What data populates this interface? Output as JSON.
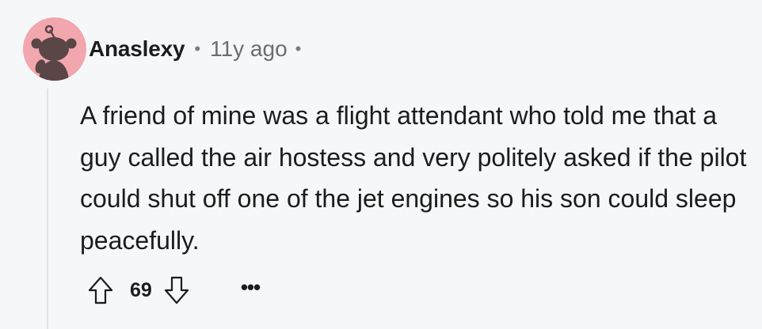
{
  "comment": {
    "username": "Anaslexy",
    "separator": "•",
    "time_ago": "11y ago",
    "body": "A friend of mine was a flight attendant who told me that a guy called the air hostess and very politely asked if the pilot could shut off one of the jet engines so his son could sleep peacefully.",
    "score": "69",
    "more_label": "•••"
  },
  "icons": {
    "avatar": "reddit-snoo-avatar",
    "upvote": "arrow-up-outline-icon",
    "downvote": "arrow-down-outline-icon",
    "more": "ellipsis-icon"
  },
  "colors": {
    "background": "#f6f7f8",
    "avatar_bg": "#f2a6ae",
    "avatar_fg": "#5a4547",
    "text": "#1c1c1c",
    "muted": "#6a6d70",
    "thread_line": "#e2e4e6"
  }
}
